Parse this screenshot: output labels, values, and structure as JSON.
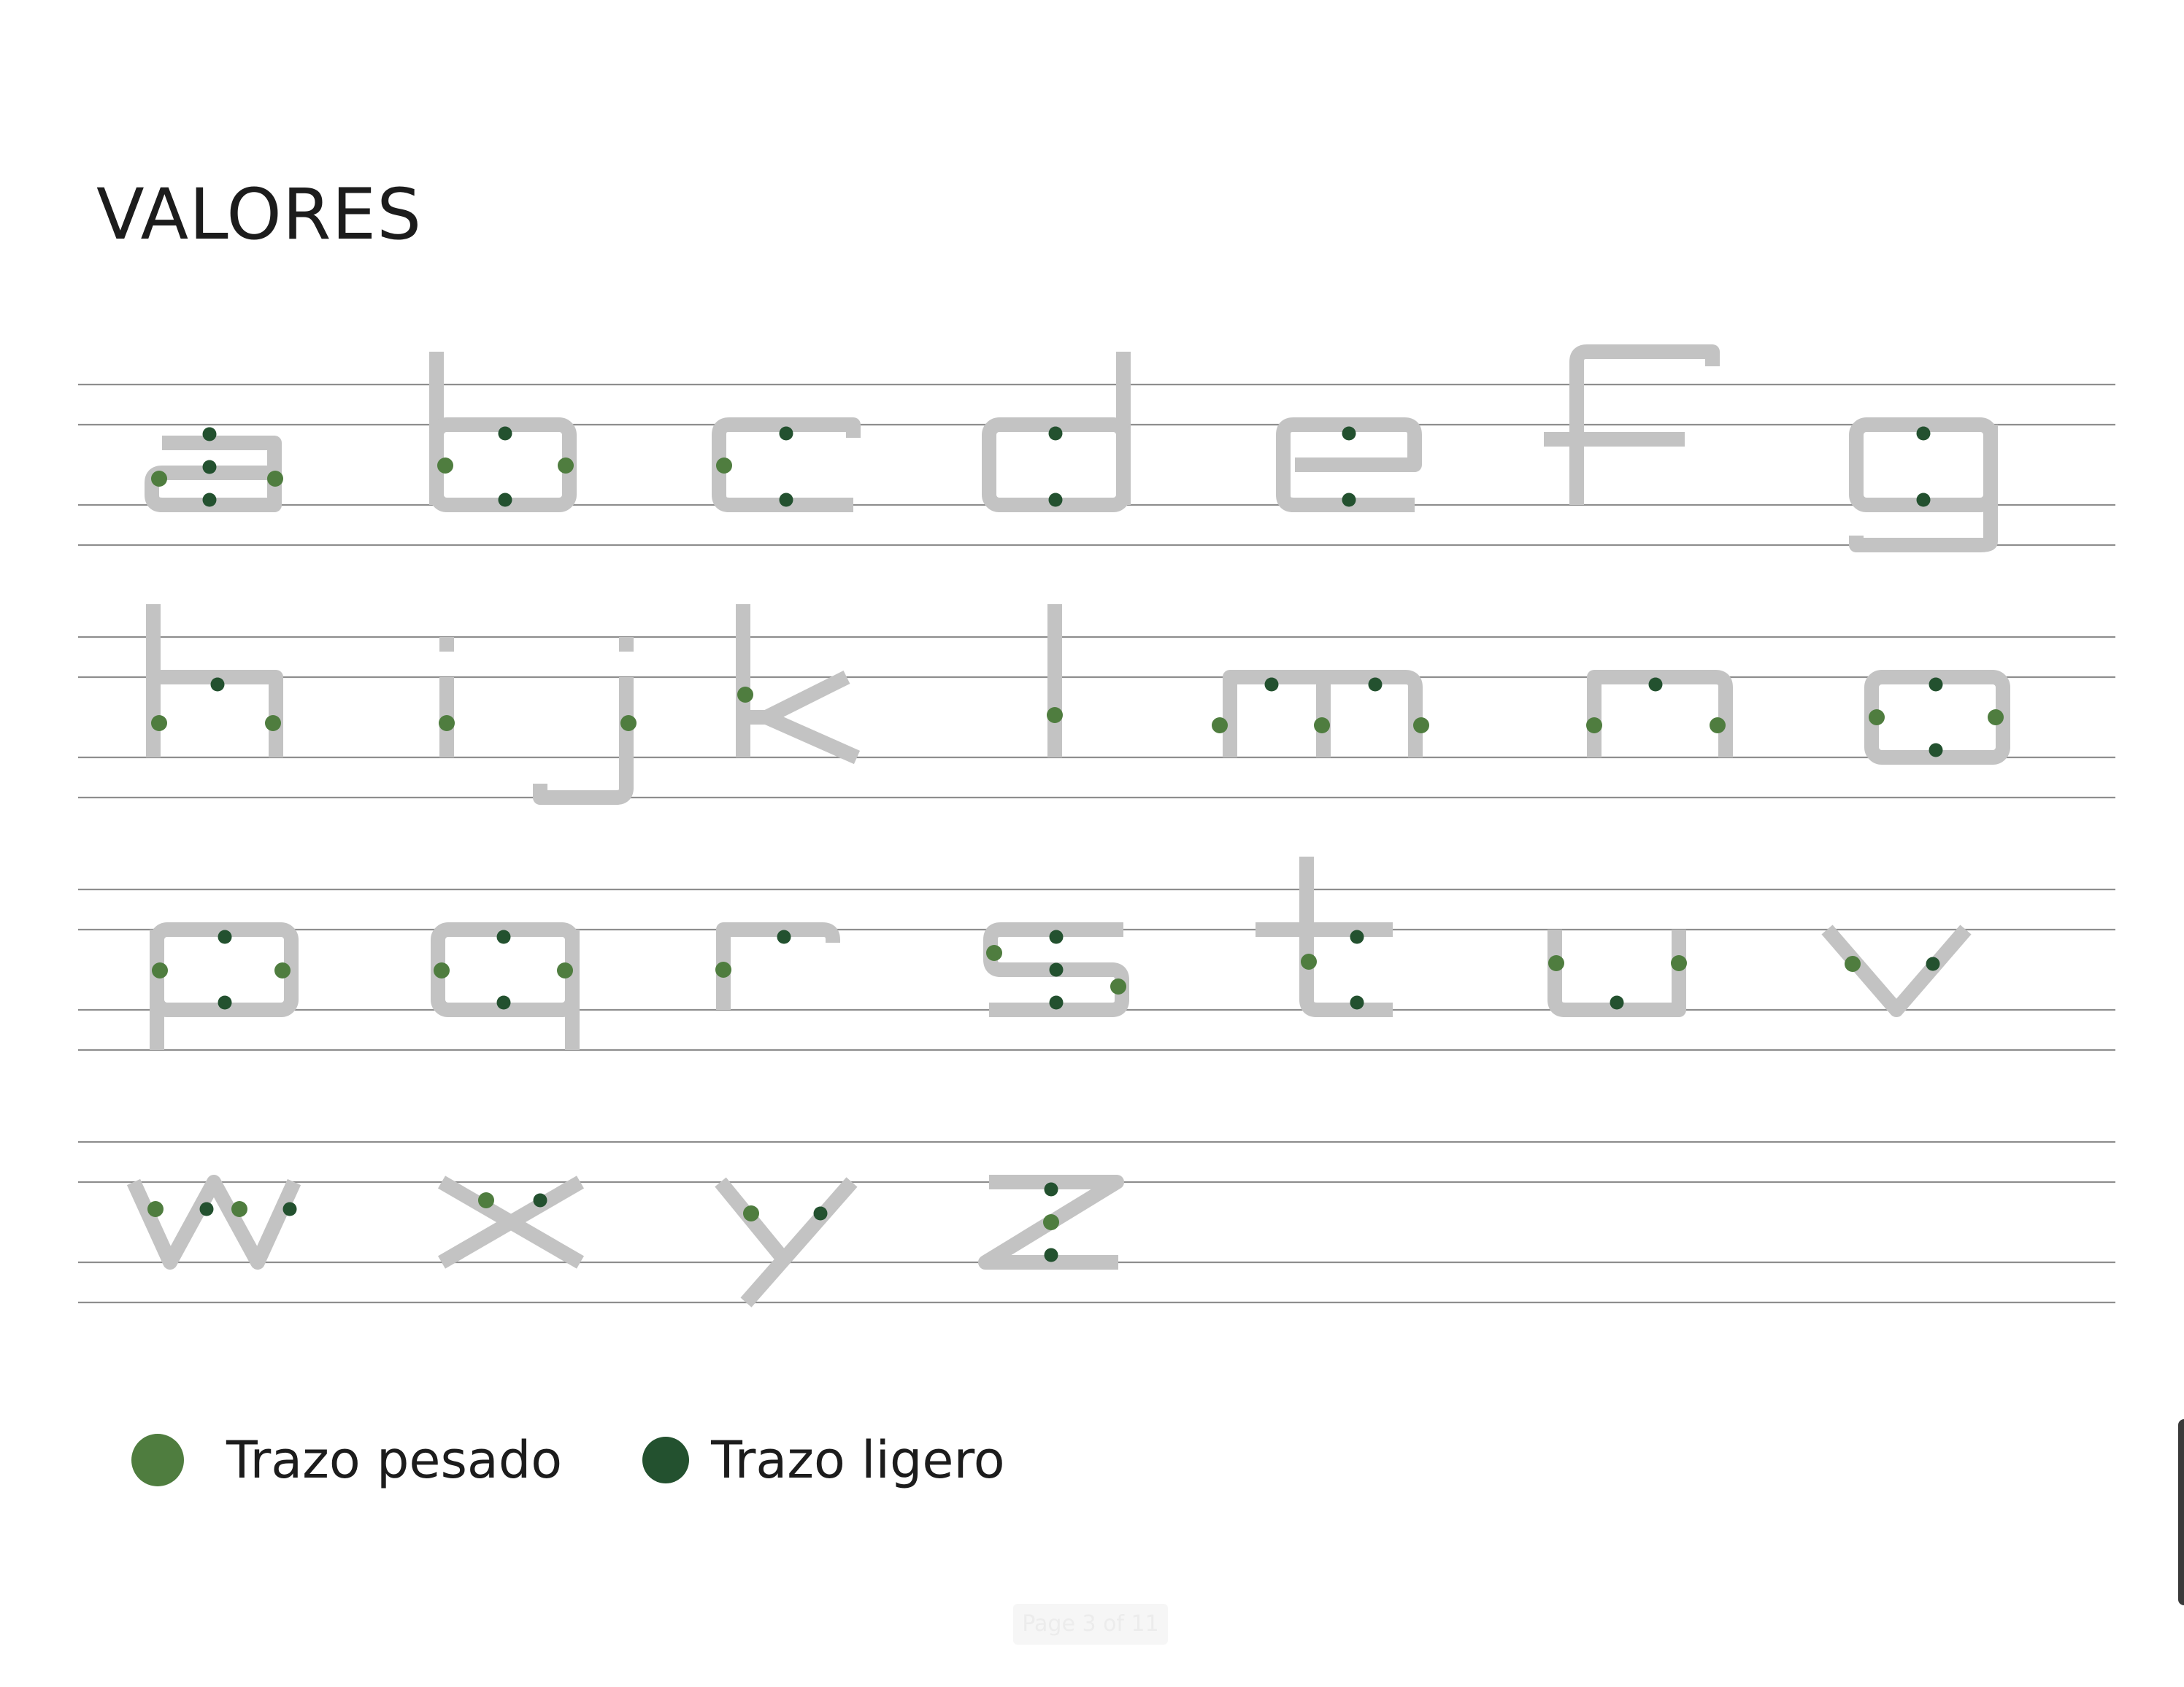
{
  "title": "VALORES",
  "colors": {
    "heavy": "#4f7d3f",
    "light": "#23512f",
    "glyph": "#c3c3c3",
    "guide": "#8e8e8e"
  },
  "legend": [
    {
      "key": "heavy",
      "label": "Trazo pesado"
    },
    {
      "key": "light",
      "label": "Trazo ligero"
    }
  ],
  "rows": [
    [
      "a",
      "b",
      "c",
      "d",
      "e",
      "f",
      "g"
    ],
    [
      "h",
      "i",
      "j",
      "k",
      "l",
      "m",
      "n",
      "o"
    ],
    [
      "p",
      "q",
      "r",
      "s",
      "t",
      "u",
      "v"
    ],
    [
      "w",
      "x",
      "y",
      "z"
    ]
  ],
  "page_indicator": "Page 3 of 11"
}
